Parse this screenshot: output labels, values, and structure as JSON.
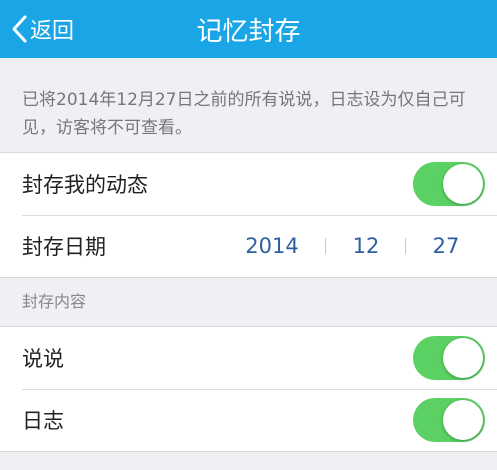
{
  "header": {
    "back_label": "返回",
    "title": "记忆封存",
    "bg_color": "#1aa6e6"
  },
  "description": "已将2014年12月27日之前的所有说说，日志设为仅自己可见，访客将不可查看。",
  "settings": {
    "archive_feed": {
      "label": "封存我的动态",
      "enabled": true
    },
    "archive_date": {
      "label": "封存日期",
      "year": "2014",
      "month": "12",
      "day": "27"
    }
  },
  "content_section": {
    "title": "封存内容",
    "items": [
      {
        "label": "说说",
        "enabled": true
      },
      {
        "label": "日志",
        "enabled": true
      }
    ]
  },
  "colors": {
    "toggle_on": "#5bd063",
    "date_text": "#2e5fa1",
    "background": "#efeff4"
  },
  "icons": {
    "back": "chevron-left-icon"
  }
}
